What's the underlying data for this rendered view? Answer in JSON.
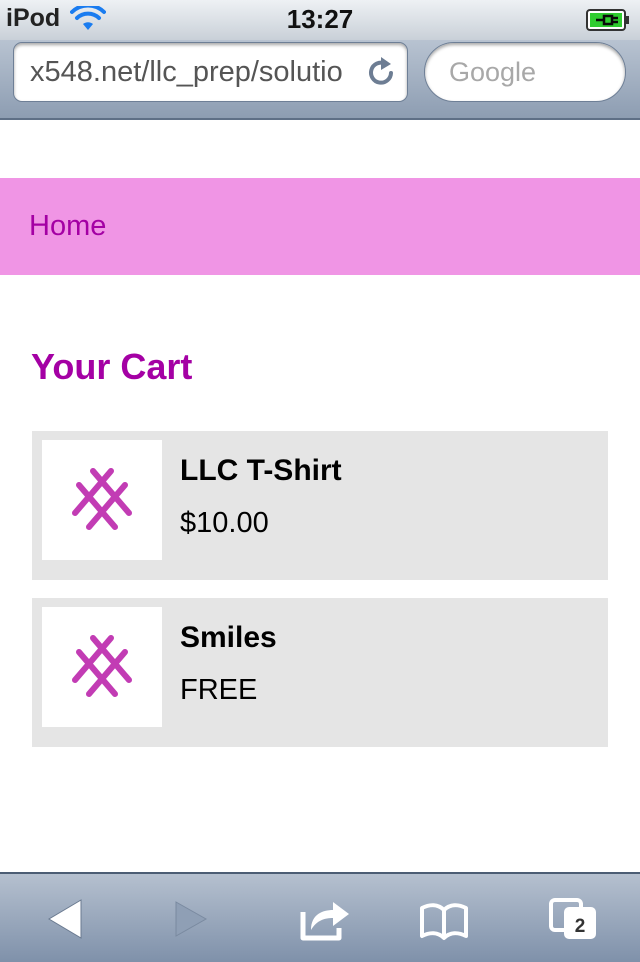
{
  "status_bar": {
    "carrier": "iPod",
    "time": "13:27",
    "icons": [
      "wifi-icon",
      "battery-charging-icon"
    ]
  },
  "browser": {
    "url": "x548.net/llc_prep/solutio",
    "search_placeholder": "Google",
    "open_tabs_count": "2"
  },
  "page": {
    "nav": {
      "home_label": "Home"
    },
    "cart_title": "Your Cart",
    "items": [
      {
        "name": "LLC T-Shirt",
        "price": "$10.00",
        "icon": "llc-logo-icon"
      },
      {
        "name": "Smiles",
        "price": "FREE",
        "icon": "llc-logo-icon"
      }
    ]
  },
  "colors": {
    "nav_background": "#f095e5",
    "accent": "#a400a4",
    "item_background": "#e5e5e5"
  }
}
